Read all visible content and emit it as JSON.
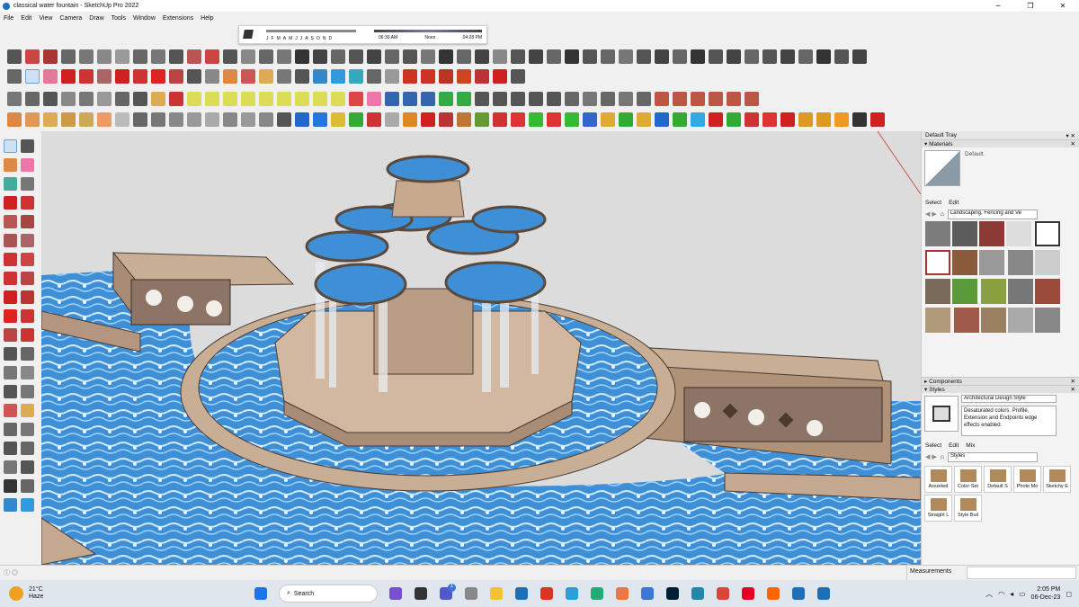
{
  "window": {
    "title": "classical water fountain - SketchUp Pro 2022",
    "minimize": "─",
    "maximize": "❐",
    "close": "✕"
  },
  "menu": [
    "File",
    "Edit",
    "View",
    "Camera",
    "Draw",
    "Tools",
    "Window",
    "Extensions",
    "Help"
  ],
  "shadows": {
    "months": [
      "J",
      "F",
      "M",
      "A",
      "M",
      "J",
      "J",
      "A",
      "S",
      "O",
      "N",
      "D"
    ],
    "time_start": "06:30 AM",
    "time_mid": "Noon",
    "time_end": "04:28 PM"
  },
  "tray": {
    "title": "Default Tray",
    "materials": {
      "header": "Materials",
      "current_name": "Default",
      "tab_select": "Select",
      "tab_edit": "Edit",
      "library": "Landscaping, Fencing and Ve"
    },
    "components": {
      "header": "Components"
    },
    "styles": {
      "header": "Styles",
      "current_name": "Architectural Design Style",
      "description": "Desaturated colors. Profile, Extension and Endpoints edge effects enabled.",
      "tab_select": "Select",
      "tab_edit": "Edit",
      "tab_mix": "Mix",
      "library": "Styles",
      "items": [
        "Assorted",
        "Color Set",
        "Default S",
        "Photo Mo",
        "Sketchy E",
        "Straight L",
        "Style Buil"
      ]
    }
  },
  "status": {
    "measurements_label": "Measurements"
  },
  "taskbar": {
    "weather_temp": "21°C",
    "weather_desc": "Haze",
    "search_placeholder": "Search",
    "time": "2:05 PM",
    "date": "06-Dec-23",
    "notification_count": "1"
  }
}
